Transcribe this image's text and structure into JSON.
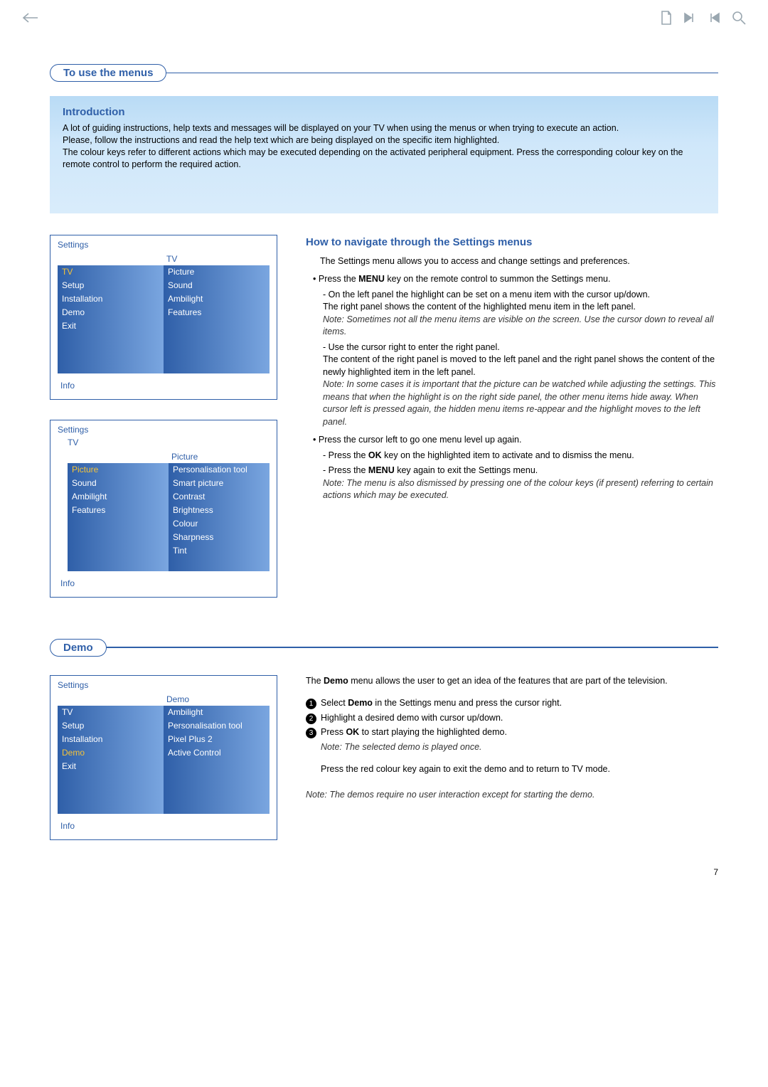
{
  "section1": {
    "title": "To use the menus"
  },
  "section2": {
    "title": "Demo"
  },
  "intro": {
    "heading": "Introduction",
    "p1": "A lot of guiding instructions, help texts and messages will be displayed on your TV when using the menus or when trying to execute an action.",
    "p2": "Please, follow the instructions and read the help text which are being displayed on the specific item highlighted.",
    "p3": "The colour keys refer to different actions which may be executed depending on the activated peripheral equipment. Press the corresponding colour key on the remote control to perform the required action."
  },
  "how": {
    "heading": "How to navigate through the Settings menus",
    "lead": "The Settings menu allows you to access and change settings and preferences.",
    "b1_prefix": "Press the ",
    "b1_key": "MENU",
    "b1_suffix": " key on the remote control to summon the Settings menu.",
    "b1_sub1": "On the left panel the highlight can be set on a menu item with the cursor up/down.",
    "b1_sub1b": "The right panel shows the content of the highlighted menu item in the left panel.",
    "b1_note": "Note: Sometimes not all the menu items are visible on the screen. Use the cursor down to reveal all items.",
    "b1_sub2": "Use the cursor right to enter the right panel.",
    "b1_sub2b": "The content of the right panel is moved to the left panel and the right panel shows the content of the newly highlighted item in the left panel.",
    "b1_note2": "Note: In some cases it is important that the picture can be watched while adjusting the settings. This means that when the highlight is on the right side panel, the other menu items hide away. When cursor left is pressed again, the hidden menu items re-appear and the highlight moves to the left panel.",
    "b2": "Press the cursor left to go one menu level up again.",
    "b2_sub1_prefix": "Press the ",
    "b2_sub1_key": "OK",
    "b2_sub1_suffix": " key on the highlighted item to activate and to dismiss the menu.",
    "b2_sub2_prefix": "Press the ",
    "b2_sub2_key": "MENU",
    "b2_sub2_suffix": " key again to exit the Settings menu.",
    "b2_note": "Note: The menu is also dismissed by pressing one of the colour keys (if present) referring to certain actions which may be executed."
  },
  "menu1": {
    "title": "Settings",
    "left_h": "",
    "right_h": "TV",
    "left": [
      "TV",
      "Setup",
      "Installation",
      "Demo",
      "Exit",
      "",
      "",
      ""
    ],
    "left_hl": 0,
    "right": [
      "Picture",
      "Sound",
      "Ambilight",
      "Features",
      "",
      "",
      "",
      ""
    ],
    "info": "Info"
  },
  "menu2": {
    "title": "Settings",
    "crumb": "TV",
    "left_h": "",
    "right_h": "Picture",
    "left": [
      "Picture",
      "Sound",
      "Ambilight",
      "Features",
      "",
      "",
      "",
      ""
    ],
    "left_hl": 0,
    "right": [
      "Personalisation tool",
      "Smart picture",
      "Contrast",
      "Brightness",
      "Colour",
      "Sharpness",
      "Tint",
      ""
    ],
    "info": "Info"
  },
  "demo_menu": {
    "title": "Settings",
    "right_h": "Demo",
    "left": [
      "TV",
      "Setup",
      "Installation",
      "Demo",
      "Exit",
      "",
      "",
      ""
    ],
    "left_hl": 3,
    "right": [
      "Ambilight",
      "Personalisation tool",
      "Pixel Plus 2",
      "Active Control",
      "",
      "",
      "",
      ""
    ],
    "info": "Info"
  },
  "demo": {
    "intro_prefix": "The ",
    "intro_bold": "Demo",
    "intro_suffix": " menu allows the user to get an idea of the features that are part of the television.",
    "s1_prefix": "Select ",
    "s1_bold": "Demo",
    "s1_suffix": " in the Settings menu and press the cursor right.",
    "s2": "Highlight a desired demo with cursor up/down.",
    "s3_prefix": "Press ",
    "s3_bold": "OK",
    "s3_suffix": " to start playing the highlighted demo.",
    "s3_note": "Note: The selected demo is played once.",
    "red": "Press the red colour key again to exit the demo and to return to TV mode.",
    "foot": "Note: The demos require no user interaction except for starting the demo."
  },
  "page": "7"
}
